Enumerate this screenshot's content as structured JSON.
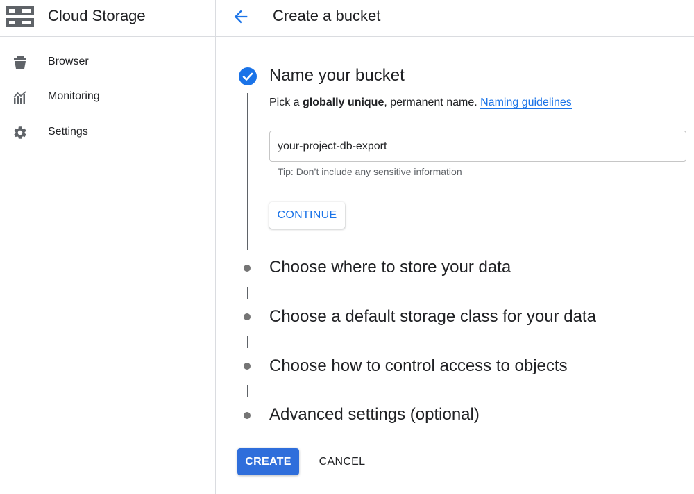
{
  "sidebar": {
    "product_name": "Cloud Storage",
    "product_icon": "storage-icon",
    "items": [
      {
        "label": "Browser",
        "icon": "bucket-icon"
      },
      {
        "label": "Monitoring",
        "icon": "chart-icon"
      },
      {
        "label": "Settings",
        "icon": "gear-icon"
      }
    ]
  },
  "header": {
    "back_icon": "arrow-back-icon",
    "title": "Create a bucket"
  },
  "steps": [
    {
      "title": "Name your bucket",
      "status": "completed",
      "description_prefix": "Pick a ",
      "description_bold": "globally unique",
      "description_suffix": ", permanent name. ",
      "link_label": "Naming guidelines",
      "input_value": "your-project-db-export",
      "tip": "Tip: Don’t include any sensitive information",
      "continue_label": "CONTINUE"
    },
    {
      "title": "Choose where to store your data",
      "status": "pending"
    },
    {
      "title": "Choose a default storage class for your data",
      "status": "pending"
    },
    {
      "title": "Choose how to control access to objects",
      "status": "pending"
    },
    {
      "title": "Advanced settings (optional)",
      "status": "pending"
    }
  ],
  "actions": {
    "create_label": "CREATE",
    "cancel_label": "CANCEL"
  },
  "colors": {
    "accent": "#1a73e8",
    "primary_button": "#2f6edb",
    "divider": "#dadce0",
    "icon_gray": "#5f6368"
  }
}
